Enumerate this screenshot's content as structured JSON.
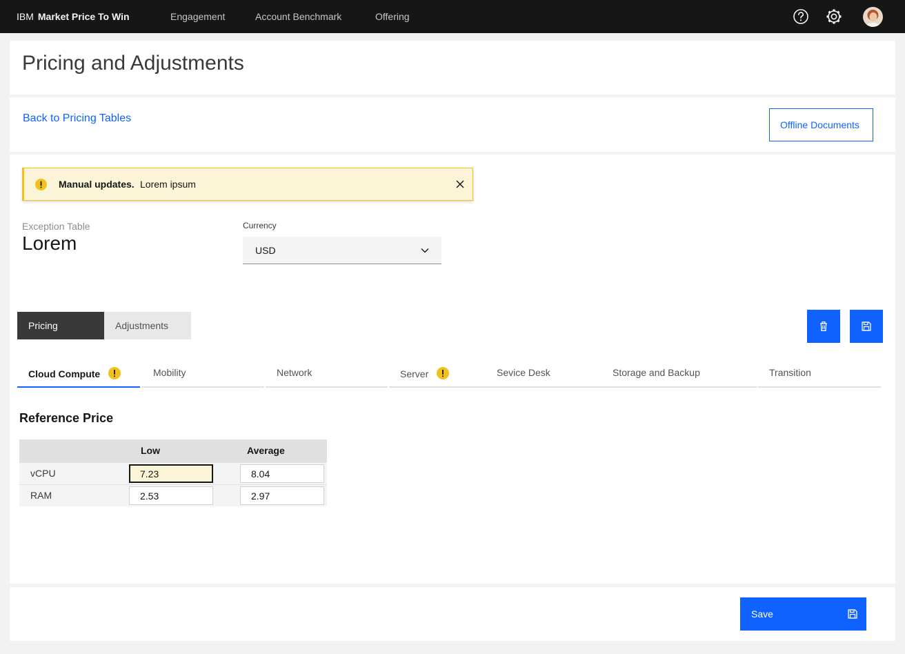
{
  "header": {
    "brand_prefix": "IBM",
    "brand_name": "Market Price To Win",
    "nav": [
      "Engagement",
      "Account Benchmark",
      "Offering"
    ],
    "icons": [
      "help-icon",
      "settings-icon",
      "user-avatar"
    ]
  },
  "page": {
    "title": "Pricing and Adjustments",
    "back_link": "Back to Pricing Tables",
    "offline_button": "Offline Documents"
  },
  "notification": {
    "title": "Manual updates.",
    "subtitle": "Lorem ipsum",
    "kind": "warning",
    "icons": [
      "warning-icon",
      "close-icon"
    ]
  },
  "exception_table": {
    "label": "Exception Table",
    "value": "Lorem"
  },
  "currency": {
    "label": "Currency",
    "value": "USD"
  },
  "switcher": {
    "items": [
      "Pricing",
      "Adjustments"
    ],
    "selected": "Pricing"
  },
  "action_buttons": [
    "delete-icon",
    "save-icon"
  ],
  "tabs": [
    {
      "label": "Cloud Compute",
      "active": true,
      "warning": true
    },
    {
      "label": "Mobility",
      "active": false,
      "warning": false
    },
    {
      "label": "Network",
      "active": false,
      "warning": false
    },
    {
      "label": "Server",
      "active": false,
      "warning": true
    },
    {
      "label": "Sevice Desk",
      "active": false,
      "warning": false
    },
    {
      "label": "Storage and Backup",
      "active": false,
      "warning": false
    },
    {
      "label": "Transition",
      "active": false,
      "warning": false
    }
  ],
  "reference_price": {
    "title": "Reference Price",
    "columns": [
      "Low",
      "Average"
    ],
    "rows": [
      {
        "label": "vCPU",
        "low": "7.23",
        "average": "8.04"
      },
      {
        "label": "RAM",
        "low": "2.53",
        "average": "2.97"
      }
    ]
  },
  "footer": {
    "save_label": "Save"
  },
  "colors": {
    "header_bg": "#161616",
    "primary": "#0f62fe",
    "warning": "#f1c21b",
    "warning_bg": "#fcf4d6"
  }
}
